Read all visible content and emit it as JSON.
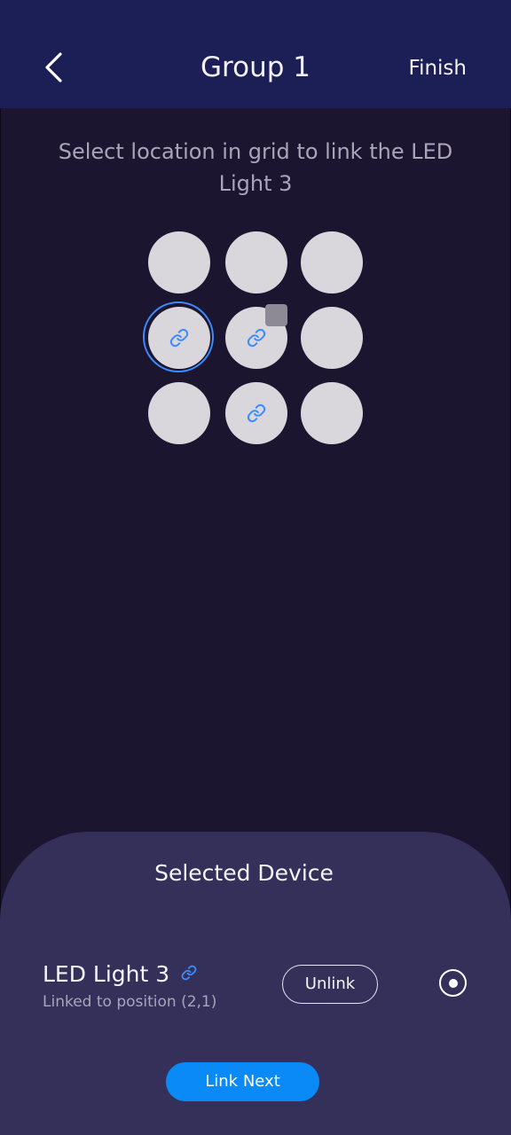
{
  "header": {
    "title": "Group 1",
    "finish_label": "Finish",
    "back_icon": "chevron-left-icon"
  },
  "instruction": "Select location in grid to link the LED Light 3",
  "grid": {
    "rows": 3,
    "cols": 3,
    "cells": [
      {
        "row": 1,
        "col": 1,
        "linked": false,
        "selected": false
      },
      {
        "row": 1,
        "col": 2,
        "linked": false,
        "selected": false
      },
      {
        "row": 1,
        "col": 3,
        "linked": false,
        "selected": false
      },
      {
        "row": 2,
        "col": 1,
        "linked": true,
        "selected": true
      },
      {
        "row": 2,
        "col": 2,
        "linked": true,
        "selected": false
      },
      {
        "row": 2,
        "col": 3,
        "linked": false,
        "selected": false
      },
      {
        "row": 3,
        "col": 1,
        "linked": false,
        "selected": false
      },
      {
        "row": 3,
        "col": 2,
        "linked": true,
        "selected": false
      },
      {
        "row": 3,
        "col": 3,
        "linked": false,
        "selected": false
      }
    ],
    "link_icon": "link-icon"
  },
  "sheet": {
    "title": "Selected Device",
    "device_name": "LED Light 3",
    "device_status": "Linked to position (2,1)",
    "unlink_label": "Unlink",
    "link_next_label": "Link Next",
    "radio_selected": true
  },
  "colors": {
    "background": "#1c1530",
    "header": "#1b1f55",
    "sheet": "#35305a",
    "accent": "#0a8af7",
    "cell": "#d9d6dc",
    "link_icon": "#3a8cff"
  }
}
